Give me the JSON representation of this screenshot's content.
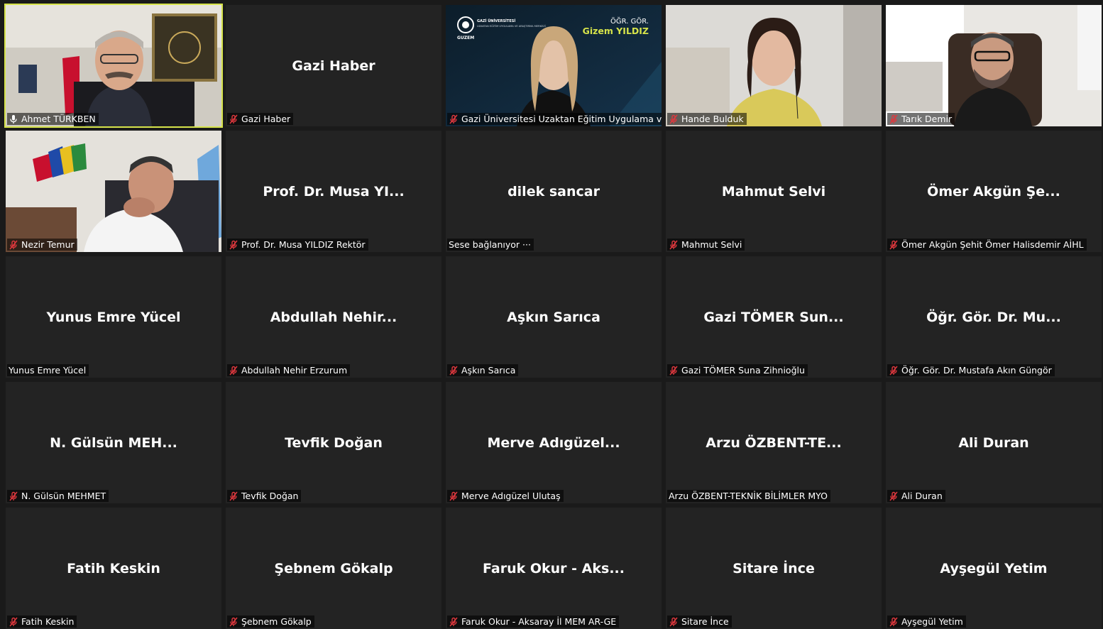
{
  "colors": {
    "tile_bg": "#232323",
    "active_speaker_border": "#d6e34a",
    "muted_icon": "#e0383e"
  },
  "participants": [
    {
      "big": "",
      "label": "Ahmet TÜRKBEN",
      "mic": "unmuted",
      "video": "man-flag",
      "active": true
    },
    {
      "big": "Gazi Haber",
      "label": "Gazi Haber",
      "mic": "muted"
    },
    {
      "big": "",
      "label": "Gazi Üniversitesi Uzaktan Eğitim Uygulama ve ...",
      "mic": "muted",
      "video": "gizem",
      "overlay": {
        "title_small": "ÖĞR. GÖR.",
        "title_name": "Gizem YILDIZ",
        "logo_text": "GAZİ ÜNİVERSİTESİ",
        "logo_sub": "UZAKTAN EĞİTİM UYGULAMA VE ARAŞTIRMA MERKEZİ",
        "logo_word": "GUZEM"
      }
    },
    {
      "big": "",
      "label": "Hande Bulduk",
      "mic": "muted",
      "video": "woman-room"
    },
    {
      "big": "",
      "label": "Tarık Demir",
      "mic": "muted",
      "video": "man-chair"
    },
    {
      "big": "",
      "label": "Nezir Temur",
      "mic": "muted",
      "video": "man-flags"
    },
    {
      "big": "Prof. Dr. Musa YI...",
      "label": "Prof. Dr. Musa YILDIZ Rektör",
      "mic": "muted"
    },
    {
      "big": "dilek sancar",
      "label": "Sese bağlanıyor ···",
      "mic": "none"
    },
    {
      "big": "Mahmut Selvi",
      "label": "Mahmut Selvi",
      "mic": "muted"
    },
    {
      "big": "Ömer Akgün Şe...",
      "label": "Ömer Akgün Şehit Ömer Halisdemir AİHL",
      "mic": "muted"
    },
    {
      "big": "Yunus Emre Yücel",
      "label": "Yunus Emre Yücel",
      "mic": "none"
    },
    {
      "big": "Abdullah Nehir...",
      "label": "Abdullah Nehir Erzurum",
      "mic": "muted"
    },
    {
      "big": "Aşkın Sarıca",
      "label": "Aşkın Sarıca",
      "mic": "muted"
    },
    {
      "big": "Gazi TÖMER Sun...",
      "label": "Gazi TÖMER Suna Zihnioğlu",
      "mic": "muted"
    },
    {
      "big": "Öğr. Gör. Dr. Mu...",
      "label": "Öğr. Gör. Dr. Mustafa Akın Güngör",
      "mic": "muted"
    },
    {
      "big": "N. Gülsün MEH...",
      "label": "N. Gülsün MEHMET",
      "mic": "muted"
    },
    {
      "big": "Tevfik Doğan",
      "label": "Tevfik Doğan",
      "mic": "muted"
    },
    {
      "big": "Merve Adıgüzel...",
      "label": "Merve Adıgüzel Ulutaş",
      "mic": "muted"
    },
    {
      "big": "Arzu ÖZBENT-TE...",
      "label": "Arzu ÖZBENT-TEKNİK BİLİMLER MYO",
      "mic": "none"
    },
    {
      "big": "Ali Duran",
      "label": "Ali Duran",
      "mic": "muted"
    },
    {
      "big": "Fatih Keskin",
      "label": "Fatih Keskin",
      "mic": "muted"
    },
    {
      "big": "Şebnem Gökalp",
      "label": "Şebnem Gökalp",
      "mic": "muted"
    },
    {
      "big": "Faruk Okur - Aks...",
      "label": "Faruk Okur - Aksaray İl MEM AR-GE",
      "mic": "muted"
    },
    {
      "big": "Sitare İnce",
      "label": "Sitare İnce",
      "mic": "muted"
    },
    {
      "big": "Ayşegül Yetim",
      "label": "Ayşegül Yetim",
      "mic": "muted"
    }
  ]
}
